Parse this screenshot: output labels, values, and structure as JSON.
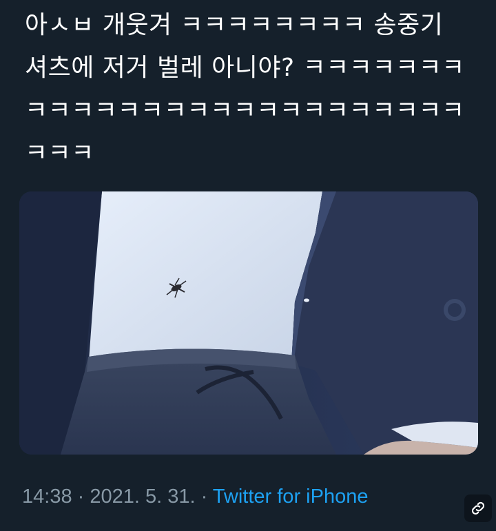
{
  "tweet": {
    "text_lines": [
      "아ㅅㅂ 개웃겨 ㅋㅋㅋㅋㅋㅋㅋㅋ 송중기",
      "셔츠에 저거 벌레 아니야? ㅋㅋㅋㅋㅋㅋㅋ",
      "ㅋㅋㅋㅋㅋㅋㅋㅋㅋㅋㅋㅋㅋㅋㅋㅋㅋㅋㅋ",
      "ㅋㅋㅋ"
    ],
    "media": {
      "description_icon": "photo"
    },
    "meta": {
      "time": "14:38",
      "separator": " · ",
      "date": "2021. 5. 31.",
      "separator2": " · ",
      "source": "Twitter for iPhone"
    }
  },
  "icons": {
    "link": "link-icon"
  },
  "colors": {
    "background": "#15202b",
    "text": "#ffffff",
    "meta": "#8899a6",
    "source_link": "#1da1f2"
  }
}
